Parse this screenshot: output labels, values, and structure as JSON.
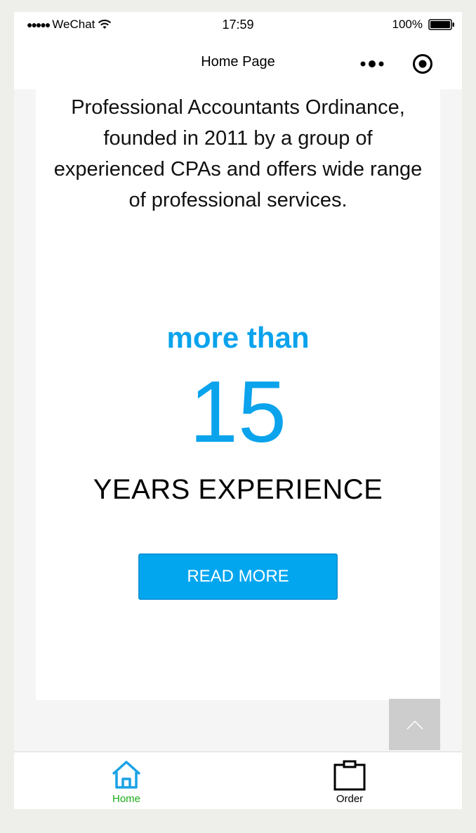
{
  "status_bar": {
    "signal": "●●●●●",
    "carrier": "WeChat",
    "time": "17:59",
    "battery": "100%"
  },
  "nav": {
    "title": "Home Page",
    "more_icon": "more-dots-icon",
    "target_icon": "record-target-icon"
  },
  "content": {
    "intro": "Professional Accountants Ordinance, founded in 2011 by a group of experienced CPAs and offers wide range of professional services.",
    "more_than": "more than",
    "years_number": "15",
    "years_label": "YEARS EXPERIENCE",
    "read_more_label": "READ MORE"
  },
  "back_to_top": {
    "icon": "chevron-up-icon"
  },
  "tab_bar": {
    "items": [
      {
        "label": "Home",
        "icon": "home-icon",
        "active": true
      },
      {
        "label": "Order",
        "icon": "clipboard-icon",
        "active": false
      }
    ]
  },
  "colors": {
    "accent": "#0aa3ec",
    "button": "#02a6ef",
    "tab_active": "#1aad19",
    "home_icon": "#1aa1e5"
  }
}
